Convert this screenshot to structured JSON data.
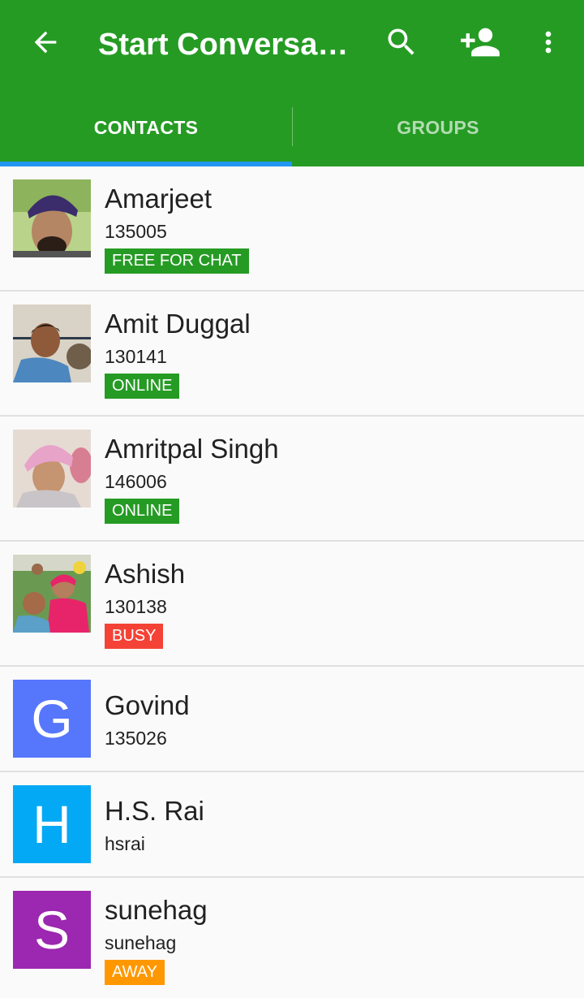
{
  "appbar": {
    "title": "Start Conversati…",
    "color": "#259b24"
  },
  "icons": {
    "back": "arrow-back-icon",
    "search": "search-icon",
    "add_contact": "person-add-icon",
    "more": "more-vertical-icon"
  },
  "tabs": [
    {
      "label": "CONTACTS",
      "selected": true
    },
    {
      "label": "GROUPS",
      "selected": false
    }
  ],
  "status_colors": {
    "FREE FOR CHAT": "#259b24",
    "ONLINE": "#259b24",
    "BUSY": "#f44336",
    "AWAY": "#ff9800"
  },
  "contacts": [
    {
      "name": "Amarjeet",
      "number": "135005",
      "status": "FREE FOR CHAT",
      "avatar": "photo"
    },
    {
      "name": "Amit Duggal",
      "number": "130141",
      "status": "ONLINE",
      "avatar": "photo"
    },
    {
      "name": "Amritpal Singh",
      "number": "146006",
      "status": "ONLINE",
      "avatar": "photo"
    },
    {
      "name": "Ashish",
      "number": "130138",
      "status": "BUSY",
      "avatar": "photo"
    },
    {
      "name": "Govind",
      "number": "135026",
      "status": "",
      "avatar": "letter",
      "letter": "G",
      "avatar_color": "#5677fc"
    },
    {
      "name": "H.S. Rai",
      "number": "hsrai",
      "status": "",
      "avatar": "letter",
      "letter": "H",
      "avatar_color": "#03a9f4"
    },
    {
      "name": "sunehag",
      "number": "sunehag",
      "status": "AWAY",
      "avatar": "letter",
      "letter": "S",
      "avatar_color": "#9c27b0"
    }
  ]
}
